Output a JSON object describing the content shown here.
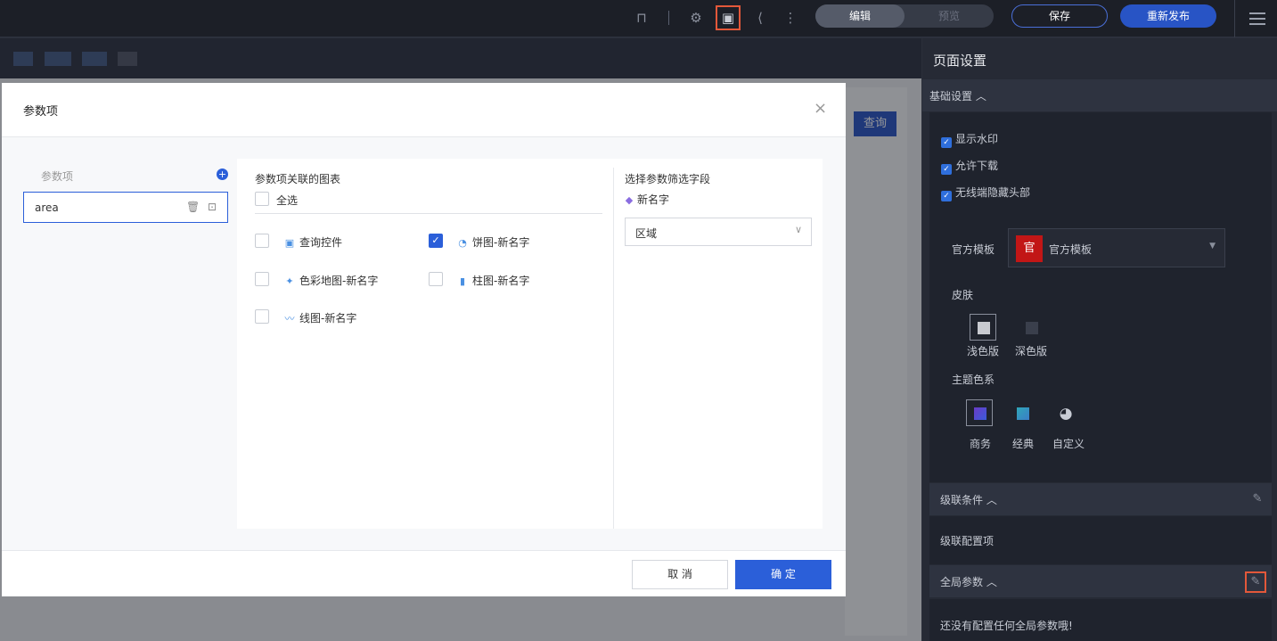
{
  "toolbar": {
    "icons": [
      "unlock-icon",
      "gear-icon",
      "page-params-icon",
      "share-icon",
      "more-icon"
    ],
    "mode_edit": "编辑",
    "mode_preview": "预览",
    "save": "保存",
    "republish": "重新发布"
  },
  "page": {
    "query_button": "查询"
  },
  "right_panel": {
    "title": "页面设置",
    "basic": {
      "header": "基础设置",
      "options": [
        "显示水印",
        "允许下载",
        "无线端隐藏头部"
      ],
      "template_label": "官方模板",
      "template_logo": "官",
      "template_value": "官方模板",
      "skin_label": "皮肤",
      "skin_light": "浅色版",
      "skin_dark": "深色版",
      "theme_label": "主题色系",
      "theme_business": "商务",
      "theme_classic": "经典",
      "theme_custom": "自定义"
    },
    "cascade": {
      "header": "级联条件",
      "body": "级联配置项"
    },
    "global_params": {
      "header": "全局参数",
      "empty": "还没有配置任何全局参数哦!"
    }
  },
  "dialog": {
    "title": "参数项",
    "list_label": "参数项",
    "params": [
      "area"
    ],
    "charts_header": "参数项关联的图表",
    "select_all": "全选",
    "charts": [
      {
        "label": "查询控件",
        "checked": false
      },
      {
        "label": "饼图-新名字",
        "checked": true
      },
      {
        "label": "色彩地图-新名字",
        "checked": false
      },
      {
        "label": "柱图-新名字",
        "checked": false
      },
      {
        "label": "线图-新名字",
        "checked": false
      }
    ],
    "field_header": "选择参数筛选字段",
    "dataset_name": "新名字",
    "field_value": "区域",
    "cancel": "取 消",
    "confirm": "确 定"
  },
  "colors": {
    "accent": "#2b5fd9",
    "highlight": "#e3583a",
    "panel_bg": "#262a35"
  }
}
